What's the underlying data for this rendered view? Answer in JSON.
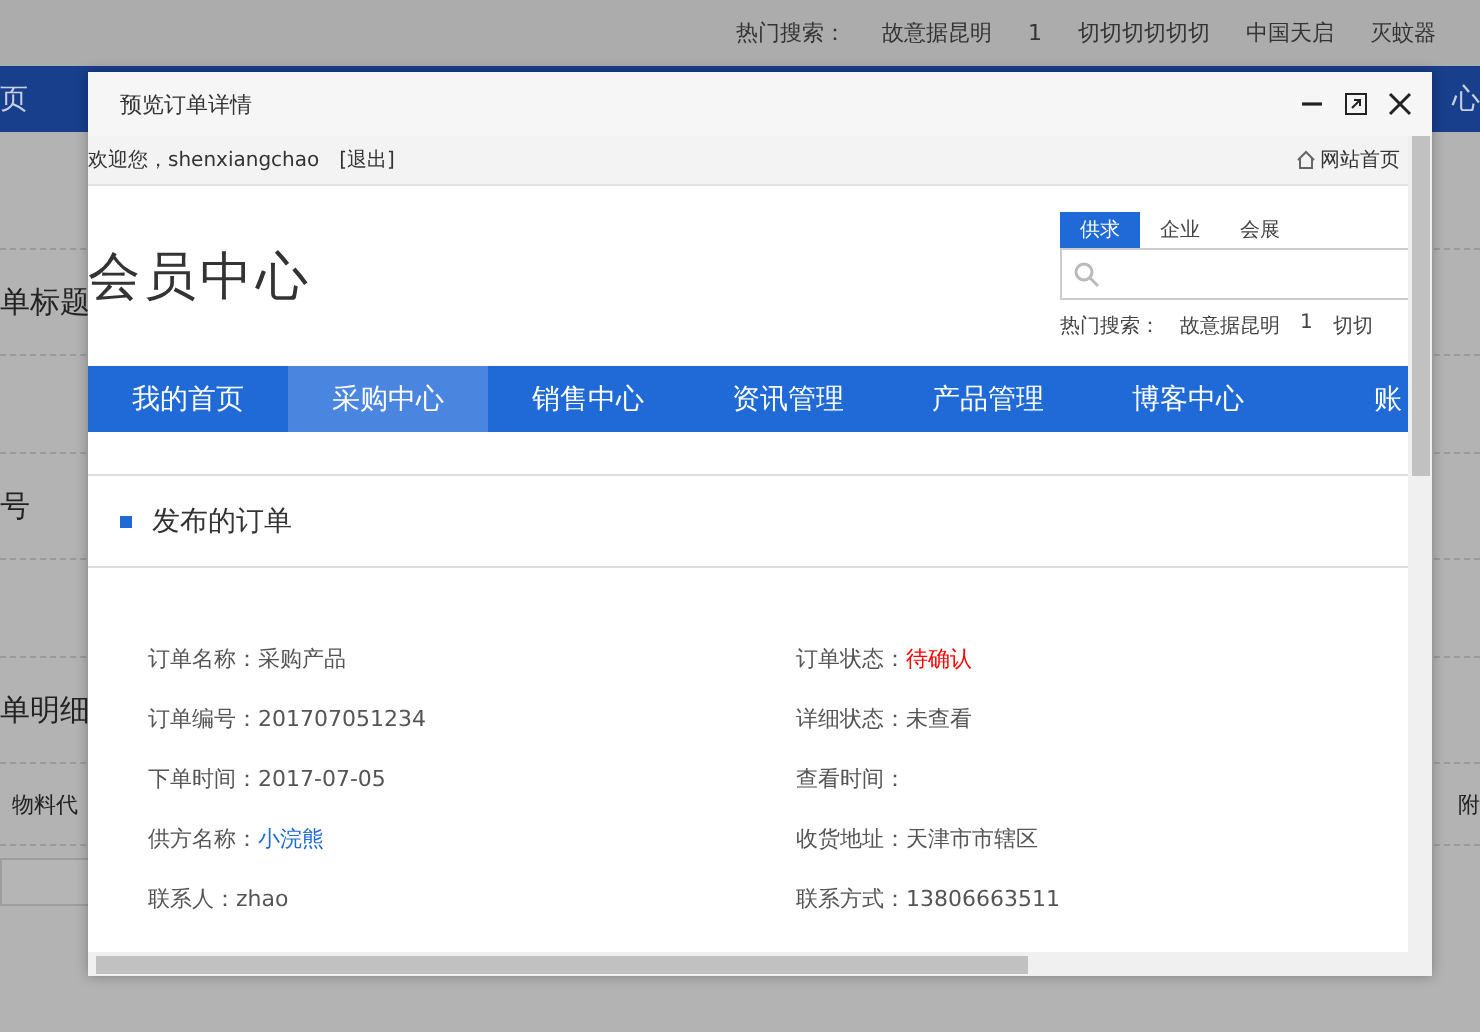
{
  "background_page": {
    "hot_search_label": "热门搜索：",
    "hot_searches": [
      "故意据昆明",
      "1",
      "切切切切切切",
      "中国天启",
      "灭蚊器"
    ],
    "nav_left": "页",
    "nav_right": "心",
    "form_labels": [
      "单标题",
      "号",
      "单明细"
    ],
    "table_header_left": "物料代",
    "table_header_right": "附"
  },
  "dialog": {
    "title": "预览订单详情",
    "welcome": "欢迎您，shenxiangchao",
    "logout": "[退出]",
    "home_link": "网站首页",
    "site_title": "会员中心",
    "search_tabs": [
      {
        "label": "供求",
        "selected": true
      },
      {
        "label": "企业",
        "selected": false
      },
      {
        "label": "会展",
        "selected": false
      }
    ],
    "hot_search_label": "热门搜索：",
    "hot_searches": [
      "故意据昆明",
      "1",
      "切切"
    ],
    "nav": [
      {
        "label": "我的首页",
        "selected": false
      },
      {
        "label": "采购中心",
        "selected": true
      },
      {
        "label": "销售中心",
        "selected": false
      },
      {
        "label": "资讯管理",
        "selected": false
      },
      {
        "label": "产品管理",
        "selected": false
      },
      {
        "label": "博客中心",
        "selected": false
      },
      {
        "label": "账",
        "selected": false
      }
    ],
    "section_title": "发布的订单",
    "fields": [
      {
        "label": "订单名称：",
        "value": "采购产品",
        "kind": "plain"
      },
      {
        "label": "订单状态：",
        "value": "待确认",
        "kind": "status"
      },
      {
        "label": "订单编号：",
        "value": "201707051234",
        "kind": "plain"
      },
      {
        "label": "详细状态：",
        "value": "未查看",
        "kind": "plain"
      },
      {
        "label": "下单时间：",
        "value": "2017-07-05",
        "kind": "plain"
      },
      {
        "label": "查看时间："
      },
      {
        "label": "供方名称：",
        "value": "小浣熊",
        "kind": "link"
      },
      {
        "label": "收货地址：",
        "value": "天津市市辖区",
        "kind": "plain"
      },
      {
        "label": "联系人：",
        "value": "zhao",
        "kind": "plain"
      },
      {
        "label": "联系方式：",
        "value": "13806663511",
        "kind": "plain"
      }
    ]
  }
}
